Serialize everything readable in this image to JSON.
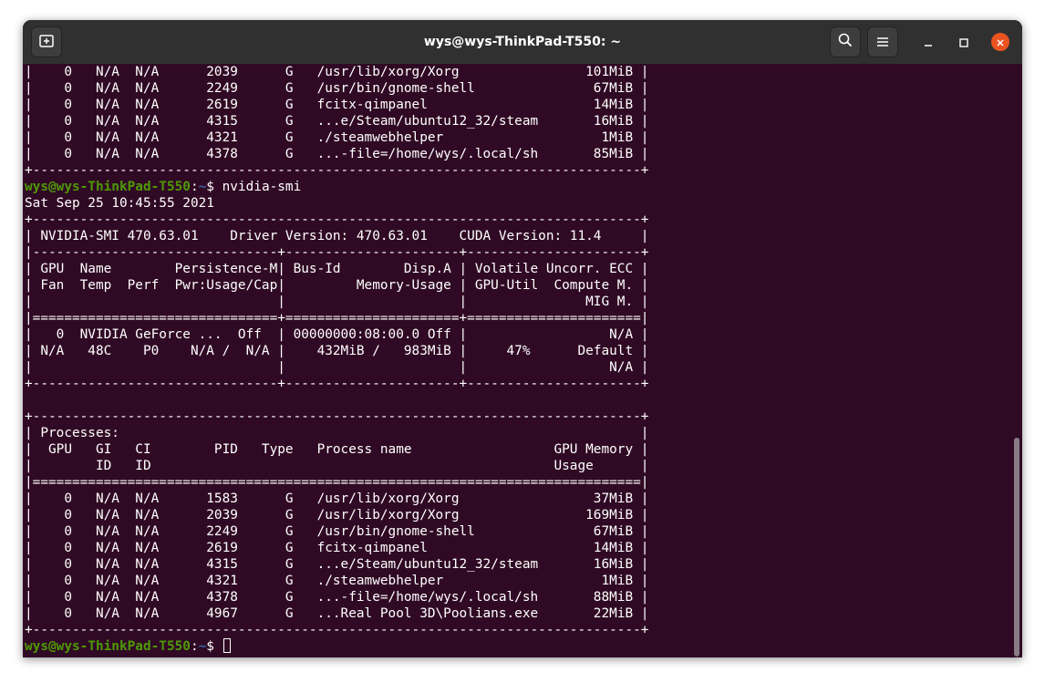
{
  "window": {
    "title": "wys@wys-ThinkPad-T550: ~"
  },
  "icons": {
    "new_tab": "new-tab-icon",
    "search": "search-icon",
    "menu": "hamburger-menu-icon",
    "minimize": "minimize-icon",
    "maximize": "maximize-icon",
    "close": "close-icon"
  },
  "colors": {
    "terminal_bg": "#300a24",
    "titlebar_bg": "#303030",
    "prompt_user": "#4e9a06",
    "prompt_path": "#3465a4",
    "close_button": "#e95420"
  },
  "prompt": {
    "user_host": "wys@wys-ThinkPad-T550",
    "separator": ":",
    "path": "~",
    "symbol": "$ "
  },
  "terminal": {
    "lines": [
      {
        "type": "text",
        "text": "|    0   N/A  N/A      2039      G   /usr/lib/xorg/Xorg                101MiB |"
      },
      {
        "type": "text",
        "text": "|    0   N/A  N/A      2249      G   /usr/bin/gnome-shell               67MiB |"
      },
      {
        "type": "text",
        "text": "|    0   N/A  N/A      2619      G   fcitx-qimpanel                     14MiB |"
      },
      {
        "type": "text",
        "text": "|    0   N/A  N/A      4315      G   ...e/Steam/ubuntu12_32/steam       16MiB |"
      },
      {
        "type": "text",
        "text": "|    0   N/A  N/A      4321      G   ./steamwebhelper                    1MiB |"
      },
      {
        "type": "text",
        "text": "|    0   N/A  N/A      4378      G   ...-file=/home/wys/.local/sh       85MiB |"
      },
      {
        "type": "text",
        "text": "+-----------------------------------------------------------------------------+"
      },
      {
        "type": "prompt",
        "command": "nvidia-smi"
      },
      {
        "type": "text",
        "text": "Sat Sep 25 10:45:55 2021"
      },
      {
        "type": "text",
        "text": "+-----------------------------------------------------------------------------+"
      },
      {
        "type": "text",
        "text": "| NVIDIA-SMI 470.63.01    Driver Version: 470.63.01    CUDA Version: 11.4     |"
      },
      {
        "type": "text",
        "text": "|-------------------------------+----------------------+----------------------+"
      },
      {
        "type": "text",
        "text": "| GPU  Name        Persistence-M| Bus-Id        Disp.A | Volatile Uncorr. ECC |"
      },
      {
        "type": "text",
        "text": "| Fan  Temp  Perf  Pwr:Usage/Cap|         Memory-Usage | GPU-Util  Compute M. |"
      },
      {
        "type": "text",
        "text": "|                               |                      |               MIG M. |"
      },
      {
        "type": "text",
        "text": "|===============================+======================+======================|"
      },
      {
        "type": "text",
        "text": "|   0  NVIDIA GeForce ...  Off  | 00000000:08:00.0 Off |                  N/A |"
      },
      {
        "type": "text",
        "text": "| N/A   48C    P0    N/A /  N/A |    432MiB /   983MiB |     47%      Default |"
      },
      {
        "type": "text",
        "text": "|                               |                      |                  N/A |"
      },
      {
        "type": "text",
        "text": "+-------------------------------+----------------------+----------------------+"
      },
      {
        "type": "text",
        "text": ""
      },
      {
        "type": "text",
        "text": "+-----------------------------------------------------------------------------+"
      },
      {
        "type": "text",
        "text": "| Processes:                                                                  |"
      },
      {
        "type": "text",
        "text": "|  GPU   GI   CI        PID   Type   Process name                  GPU Memory |"
      },
      {
        "type": "text",
        "text": "|        ID   ID                                                   Usage      |"
      },
      {
        "type": "text",
        "text": "|=============================================================================|"
      },
      {
        "type": "text",
        "text": "|    0   N/A  N/A      1583      G   /usr/lib/xorg/Xorg                 37MiB |"
      },
      {
        "type": "text",
        "text": "|    0   N/A  N/A      2039      G   /usr/lib/xorg/Xorg                169MiB |"
      },
      {
        "type": "text",
        "text": "|    0   N/A  N/A      2249      G   /usr/bin/gnome-shell               67MiB |"
      },
      {
        "type": "text",
        "text": "|    0   N/A  N/A      2619      G   fcitx-qimpanel                     14MiB |"
      },
      {
        "type": "text",
        "text": "|    0   N/A  N/A      4315      G   ...e/Steam/ubuntu12_32/steam       16MiB |"
      },
      {
        "type": "text",
        "text": "|    0   N/A  N/A      4321      G   ./steamwebhelper                    1MiB |"
      },
      {
        "type": "text",
        "text": "|    0   N/A  N/A      4378      G   ...-file=/home/wys/.local/sh       88MiB |"
      },
      {
        "type": "text",
        "text": "|    0   N/A  N/A      4967      G   ...Real Pool 3D\\Poolians.exe       22MiB |"
      },
      {
        "type": "text",
        "text": "+-----------------------------------------------------------------------------+"
      },
      {
        "type": "prompt",
        "command": "",
        "cursor": true
      }
    ]
  }
}
